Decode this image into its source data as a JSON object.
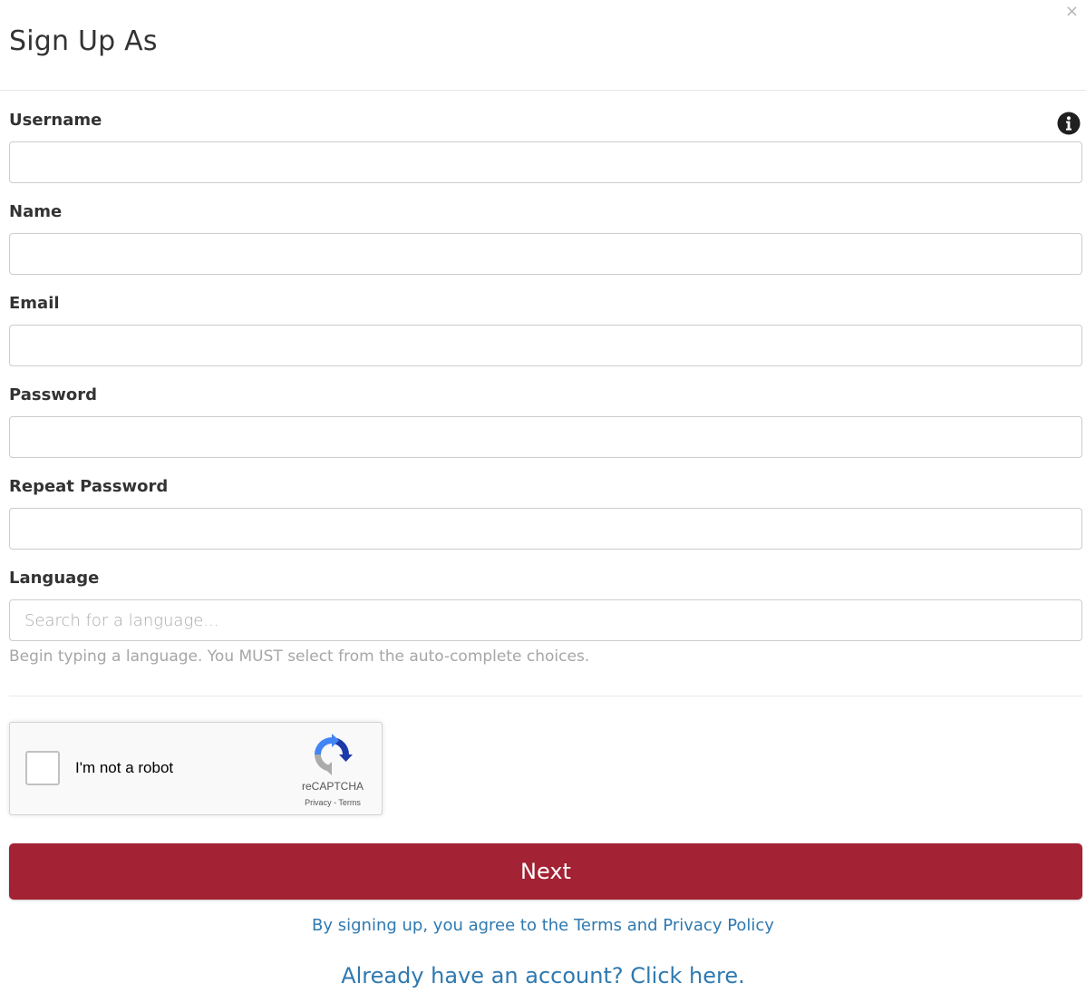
{
  "dialog": {
    "title": "Sign Up As",
    "close_icon": "close-icon"
  },
  "fields": {
    "username": {
      "label": "Username",
      "value": "",
      "info_icon": "info-icon"
    },
    "name": {
      "label": "Name",
      "value": ""
    },
    "email": {
      "label": "Email",
      "value": ""
    },
    "password": {
      "label": "Password",
      "value": ""
    },
    "repeat_password": {
      "label": "Repeat Password",
      "value": ""
    },
    "language": {
      "label": "Language",
      "placeholder": "Search for a language...",
      "help": "Begin typing a language. You MUST select from the auto-complete choices."
    }
  },
  "captcha": {
    "label": "I'm not a robot",
    "brand": "reCAPTCHA",
    "privacy": "Privacy",
    "separator": " - ",
    "terms": "Terms",
    "checked": false
  },
  "actions": {
    "next_label": "Next",
    "terms_text": "By signing up, you agree to the Terms and Privacy Policy",
    "login_text": "Already have an account? Click here."
  },
  "colors": {
    "primary_button": "#a32234",
    "link": "#2f79b0"
  }
}
